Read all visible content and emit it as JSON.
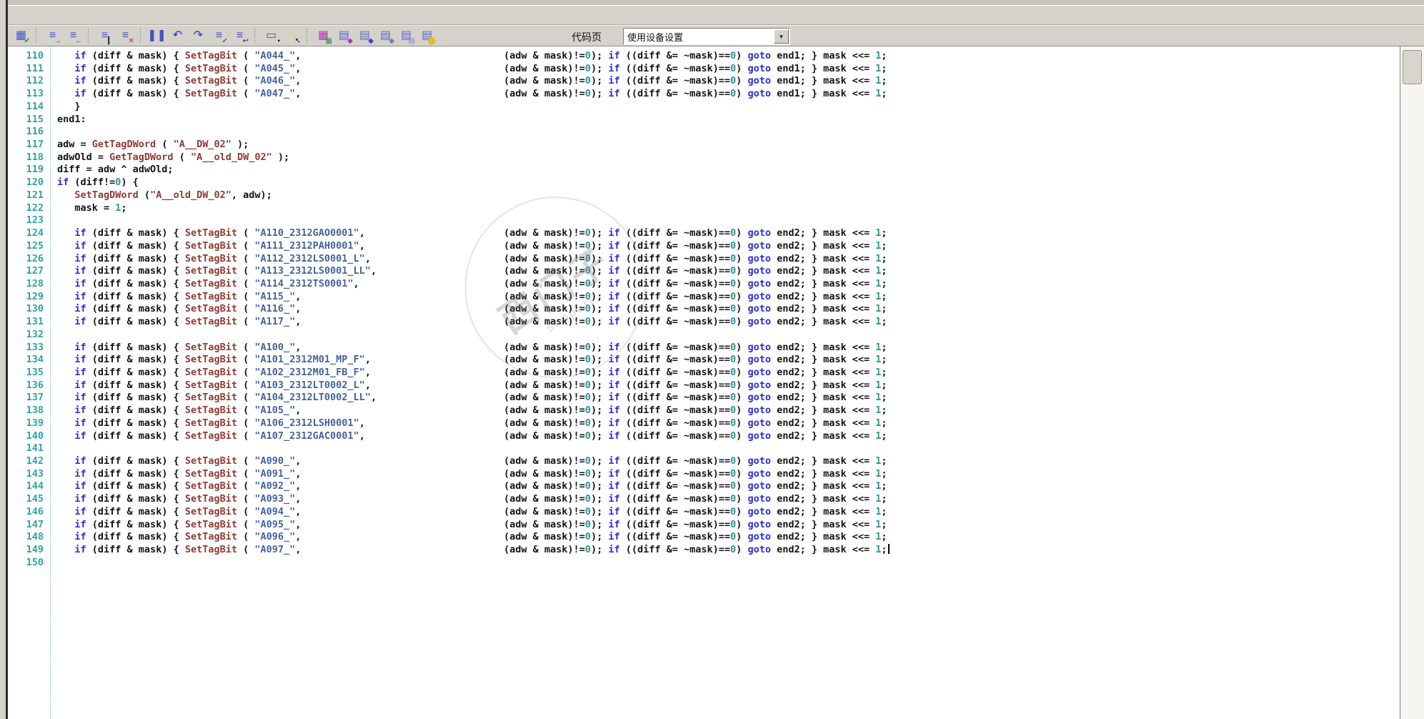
{
  "toolbar": {
    "codepage_label": "代码页",
    "codepage_value": "使用设备设置",
    "icons": [
      {
        "name": "compile-check-icon",
        "base": "▦",
        "bc": "#4553c4",
        "ov": "✔",
        "oc": "#159415"
      },
      {
        "sep": true
      },
      {
        "name": "indent-icon",
        "base": "≡",
        "bc": "#4553c4",
        "ov": "→",
        "oc": "#2b3ab0"
      },
      {
        "name": "outdent-icon",
        "base": "≡",
        "bc": "#4553c4",
        "ov": "←",
        "oc": "#2b3ab0"
      },
      {
        "sep": true
      },
      {
        "name": "toggle-bookmark-icon",
        "base": "≡",
        "bc": "#4553c4",
        "ov": "▎",
        "oc": "#222222"
      },
      {
        "name": "clear-bookmarks-icon",
        "base": "≡",
        "bc": "#4553c4",
        "ov": "✕",
        "oc": "#d82418"
      },
      {
        "sep": true
      },
      {
        "name": "split-columns-icon",
        "base": "❚❚",
        "bc": "#4553c4"
      },
      {
        "name": "undo-icon",
        "base": "↶",
        "bc": "#2b3ab0"
      },
      {
        "name": "redo-icon",
        "base": "↷",
        "bc": "#2b3ab0"
      },
      {
        "name": "apply-check-icon",
        "base": "≡",
        "bc": "#4553c4",
        "ov": "✓",
        "oc": "#1b1b60"
      },
      {
        "name": "return-lines-icon",
        "base": "≡",
        "bc": "#4553c4",
        "ov": "↩",
        "oc": "#1b1b60"
      },
      {
        "sep": true
      },
      {
        "name": "device-icon",
        "base": "▭",
        "bc": "#4553c4",
        "ov": "▪",
        "oc": "#222222"
      },
      {
        "name": "cursor-note-icon",
        "base": "▭",
        "bc": "#e6d44c",
        "ov": "↖",
        "oc": "#111111"
      },
      {
        "sep": true
      },
      {
        "name": "color-grid-icon",
        "base": "▦",
        "bc": "#b03ab0",
        "ov": "▦",
        "oc": "#3a8a3a"
      },
      {
        "name": "doc-diamond-purple-icon",
        "base": "▤",
        "bc": "#5a6ac8",
        "ov": "◆",
        "oc": "#b030c0"
      },
      {
        "name": "doc-diamond-blue-icon",
        "base": "▤",
        "bc": "#5a6ac8",
        "ov": "◆",
        "oc": "#3040d0"
      },
      {
        "name": "doc-diamond-steel-icon",
        "base": "▤",
        "bc": "#5a6ac8",
        "ov": "◆",
        "oc": "#7080b0"
      },
      {
        "name": "doc-copy-icon",
        "base": "▤",
        "bc": "#5a6ac8",
        "ov": "▤",
        "oc": "#8090c0"
      },
      {
        "name": "doc-database-icon",
        "base": "▤",
        "bc": "#5a6ac8",
        "ov": "⬤",
        "oc": "#dfc020"
      }
    ]
  },
  "editor": {
    "colors": {
      "keyword": "#2b2bdf",
      "function": "#8e3b34",
      "string_blue": "#44639e",
      "string_maroon": "#8e3b34",
      "number": "#2a9390",
      "plain": "#141414",
      "line_number": "#2fa3ab"
    },
    "templates": {
      "iftag_left": [
        [
          "p",
          "   "
        ],
        [
          "k",
          "if"
        ],
        [
          "p",
          " (diff & mask) { "
        ],
        [
          "f",
          "SetTagBit"
        ],
        [
          "p",
          " ( "
        ],
        [
          "s",
          "\"@TAG@\""
        ],
        [
          "p",
          ","
        ]
      ],
      "if_right": [
        [
          "p",
          "(adw & mask)!="
        ],
        [
          "n",
          "0"
        ],
        [
          "p",
          "); "
        ],
        [
          "k",
          "if"
        ],
        [
          "p",
          " ((diff &= ~mask)=="
        ],
        [
          "n",
          "0"
        ],
        [
          "p",
          ") "
        ],
        [
          "k",
          "goto"
        ],
        [
          "p",
          " @END@; } mask <<= "
        ],
        [
          "n",
          "1"
        ],
        [
          "p",
          ";"
        ]
      ]
    },
    "lines": [
      {
        "no": "110",
        "type": "iftag",
        "tag": "A044_",
        "end": "end1"
      },
      {
        "no": "111",
        "type": "iftag",
        "tag": "A045_",
        "end": "end1"
      },
      {
        "no": "112",
        "type": "iftag",
        "tag": "A046_",
        "end": "end1"
      },
      {
        "no": "113",
        "type": "iftag",
        "tag": "A047_",
        "end": "end1"
      },
      {
        "no": "114",
        "type": "raw",
        "tokens": [
          [
            "p",
            "   }"
          ]
        ]
      },
      {
        "no": "115",
        "type": "raw",
        "tokens": [
          [
            "p",
            "end1:"
          ]
        ]
      },
      {
        "no": "116",
        "type": "empty"
      },
      {
        "no": "117",
        "type": "raw",
        "tokens": [
          [
            "p",
            "adw = "
          ],
          [
            "f",
            "GetTagDWord"
          ],
          [
            "p",
            " ( "
          ],
          [
            "m",
            "\"A__DW_02\""
          ],
          [
            "p",
            " );"
          ]
        ]
      },
      {
        "no": "118",
        "type": "raw",
        "tokens": [
          [
            "p",
            "adwOld = "
          ],
          [
            "f",
            "GetTagDWord"
          ],
          [
            "p",
            " ( "
          ],
          [
            "m",
            "\"A__old_DW_02\""
          ],
          [
            "p",
            " );"
          ]
        ]
      },
      {
        "no": "119",
        "type": "raw",
        "tokens": [
          [
            "p",
            "diff = adw ^ adwOld;"
          ]
        ]
      },
      {
        "no": "120",
        "type": "raw",
        "tokens": [
          [
            "k",
            "if"
          ],
          [
            "p",
            " (diff!="
          ],
          [
            "n",
            "0"
          ],
          [
            "p",
            ") {"
          ]
        ]
      },
      {
        "no": "121",
        "type": "raw",
        "tokens": [
          [
            "p",
            "   "
          ],
          [
            "f",
            "SetTagDWord"
          ],
          [
            "p",
            " ("
          ],
          [
            "m",
            "\"A__old_DW_02\""
          ],
          [
            "p",
            ", adw);"
          ]
        ]
      },
      {
        "no": "122",
        "type": "raw",
        "tokens": [
          [
            "p",
            "   mask = "
          ],
          [
            "n",
            "1"
          ],
          [
            "p",
            ";"
          ]
        ]
      },
      {
        "no": "123",
        "type": "empty"
      },
      {
        "no": "124",
        "type": "iftag",
        "tag": "A110_2312GAO0001",
        "end": "end2"
      },
      {
        "no": "125",
        "type": "iftag",
        "tag": "A111_2312PAH0001",
        "end": "end2"
      },
      {
        "no": "126",
        "type": "iftag",
        "tag": "A112_2312LS0001_L",
        "end": "end2"
      },
      {
        "no": "127",
        "type": "iftag",
        "tag": "A113_2312LS0001_LL",
        "end": "end2"
      },
      {
        "no": "128",
        "type": "iftag",
        "tag": "A114_2312TS0001",
        "end": "end2"
      },
      {
        "no": "129",
        "type": "iftag",
        "tag": "A115_",
        "end": "end2"
      },
      {
        "no": "130",
        "type": "iftag",
        "tag": "A116_",
        "end": "end2"
      },
      {
        "no": "131",
        "type": "iftag",
        "tag": "A117_",
        "end": "end2"
      },
      {
        "no": "132",
        "type": "empty"
      },
      {
        "no": "133",
        "type": "iftag",
        "tag": "A100_",
        "end": "end2"
      },
      {
        "no": "134",
        "type": "iftag",
        "tag": "A101_2312M01_MP_F",
        "end": "end2"
      },
      {
        "no": "135",
        "type": "iftag",
        "tag": "A102_2312M01_FB_F",
        "end": "end2"
      },
      {
        "no": "136",
        "type": "iftag",
        "tag": "A103_2312LT0002_L",
        "end": "end2"
      },
      {
        "no": "137",
        "type": "iftag",
        "tag": "A104_2312LT0002_LL",
        "end": "end2"
      },
      {
        "no": "138",
        "type": "iftag",
        "tag": "A105_",
        "end": "end2"
      },
      {
        "no": "139",
        "type": "iftag",
        "tag": "A106_2312LSH0001",
        "end": "end2"
      },
      {
        "no": "140",
        "type": "iftag",
        "tag": "A107_2312GAC0001",
        "end": "end2"
      },
      {
        "no": "141",
        "type": "empty"
      },
      {
        "no": "142",
        "type": "iftag",
        "tag": "A090_",
        "end": "end2"
      },
      {
        "no": "143",
        "type": "iftag",
        "tag": "A091_",
        "end": "end2"
      },
      {
        "no": "144",
        "type": "iftag",
        "tag": "A092_",
        "end": "end2"
      },
      {
        "no": "145",
        "type": "iftag",
        "tag": "A093_",
        "end": "end2"
      },
      {
        "no": "146",
        "type": "iftag",
        "tag": "A094_",
        "end": "end2"
      },
      {
        "no": "147",
        "type": "iftag",
        "tag": "A095_",
        "end": "end2"
      },
      {
        "no": "148",
        "type": "iftag",
        "tag": "A096_",
        "end": "end2"
      },
      {
        "no": "149",
        "type": "iftag",
        "tag": "A097_",
        "end": "end2",
        "caret": true
      },
      {
        "no": "150",
        "type": "empty"
      }
    ]
  },
  "watermark": {
    "primary": "西门子",
    "secondary": "support"
  }
}
